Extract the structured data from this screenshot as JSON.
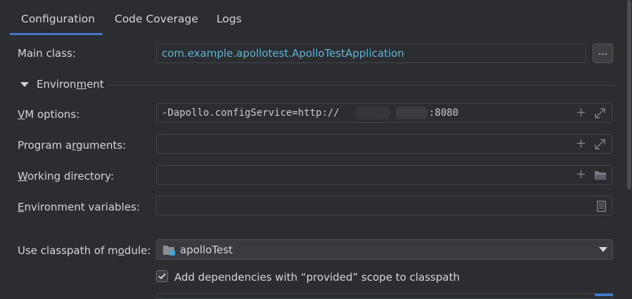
{
  "tabs": [
    {
      "label": "Configuration",
      "active": true
    },
    {
      "label": "Code Coverage",
      "active": false
    },
    {
      "label": "Logs",
      "active": false
    }
  ],
  "main_class": {
    "label": "Main class:",
    "value": "com.example.apollotest.ApolloTestApplication",
    "browse_label": "..."
  },
  "environment": {
    "label_pre": "Environ",
    "label_mnemonic": "m",
    "label_post": "ent",
    "expanded": true
  },
  "vm_options": {
    "label_mnemonic": "V",
    "label_rest": "M options:",
    "value_prefix": "-Dapollo.configService=http://",
    "value_suffix": ":8080"
  },
  "program_arguments": {
    "label_pre": "Program a",
    "label_mnemonic": "r",
    "label_post": "guments:",
    "value": ""
  },
  "working_directory": {
    "label_mnemonic": "W",
    "label_rest": "orking directory:",
    "value": ""
  },
  "environment_variables": {
    "label_mnemonic": "E",
    "label_rest": "nvironment variables:",
    "value": ""
  },
  "classpath_module": {
    "label_pre": "Use classpath of m",
    "label_mnemonic": "o",
    "label_post": "dule:",
    "value": "apolloTest"
  },
  "add_dependencies": {
    "label": "Add dependencies with “provided” scope to classpath",
    "checked": true
  },
  "colors": {
    "background": "#2b2d30",
    "accent": "#3d78c9",
    "link_text": "#5fb5d6",
    "border": "#43464b"
  },
  "icons": [
    "expand-triangle-icon",
    "plus-icon",
    "expand-icon",
    "folder-icon",
    "document-icon",
    "module-folder-icon",
    "dropdown-arrow-icon",
    "check-icon"
  ]
}
